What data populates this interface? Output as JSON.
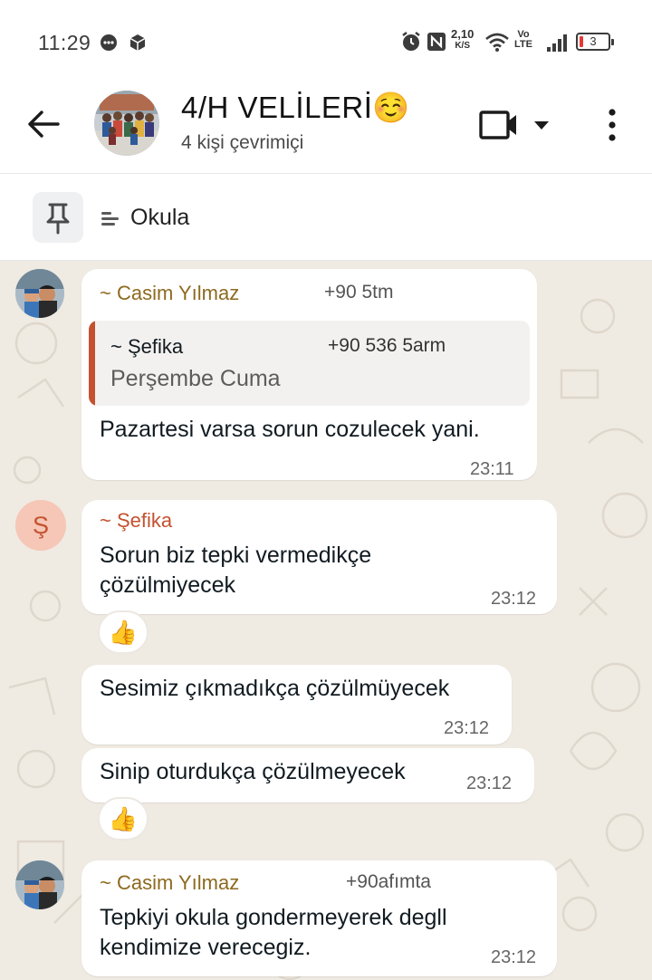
{
  "status_bar": {
    "time": "11:29",
    "net_speed_value": "2,10",
    "net_speed_unit": "K/S",
    "volte_top": "Vo",
    "volte_bottom": "LTE",
    "battery": "3"
  },
  "header": {
    "title": "4/H VELİLERİ☺️",
    "subtitle": "4 kişi çevrimiçi"
  },
  "pinned": {
    "text": "Okula"
  },
  "messages": [
    {
      "sender": "~ Casim Yılmaz",
      "phone": "+90 5tm",
      "quote_sender": "~ Şefika",
      "quote_phone": "+90 536 5arm",
      "quote_text": "Perşembe Cuma",
      "text": "Pazartesi varsa sorun cozulecek yani.",
      "time": "23:11"
    },
    {
      "avatar_letter": "Ş",
      "sender": "~ Şefika",
      "text": "Sorun biz tepki vermedikçe çözülmiyecek",
      "time": "23:12",
      "reaction": "👍"
    },
    {
      "text": "Sesimiz çıkmadıkça çözülmüyecek",
      "time": "23:12"
    },
    {
      "text": "Sinip oturdukça çözülmeyecek",
      "time": "23:12",
      "reaction": "👍"
    },
    {
      "sender": "~ Casim Yılmaz",
      "phone": "+90afımta",
      "text": "Tepkiyi okula gondermeyerek degll kendimize verecegiz.",
      "time": "23:12"
    }
  ],
  "colors": {
    "casim": "#8d6a1f",
    "sefika": "#c4522f",
    "wallpaper": "#efeae2"
  },
  "icons": [
    "back-arrow-icon",
    "video-call-icon",
    "chevron-down-icon",
    "more-vert-icon",
    "pin-icon",
    "alarm-icon",
    "nfc-icon",
    "wifi-icon",
    "signal-icon",
    "battery-icon",
    "message-icon",
    "cube-icon",
    "thumbs-up-icon"
  ]
}
